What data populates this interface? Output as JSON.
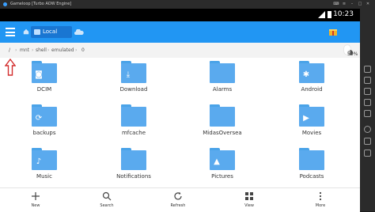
{
  "window": {
    "title": "Gameloop [Turbo AOW Engine]"
  },
  "status_bar": {
    "time": "10:23"
  },
  "app_bar": {
    "location_label": "Local"
  },
  "breadcrumb": {
    "segments": [
      "/",
      "mnt",
      "shell",
      "emulated",
      "0"
    ]
  },
  "storage": {
    "usage": "50%"
  },
  "folders": [
    {
      "name": "DCIM",
      "badge": "camera"
    },
    {
      "name": "Download",
      "badge": "download"
    },
    {
      "name": "Alarms",
      "badge": ""
    },
    {
      "name": "Android",
      "badge": "android"
    },
    {
      "name": "backups",
      "badge": "sync"
    },
    {
      "name": "mfcache",
      "badge": ""
    },
    {
      "name": "MidasOversea",
      "badge": ""
    },
    {
      "name": "Movies",
      "badge": "play"
    },
    {
      "name": "Music",
      "badge": "music"
    },
    {
      "name": "Notifications",
      "badge": ""
    },
    {
      "name": "Pictures",
      "badge": "image"
    },
    {
      "name": "Podcasts",
      "badge": ""
    }
  ],
  "bottom_bar": {
    "new": "New",
    "search": "Search",
    "refresh": "Refresh",
    "view": "View",
    "more": "More"
  },
  "colors": {
    "accent": "#2196f3",
    "folder": "#5aaaee"
  }
}
